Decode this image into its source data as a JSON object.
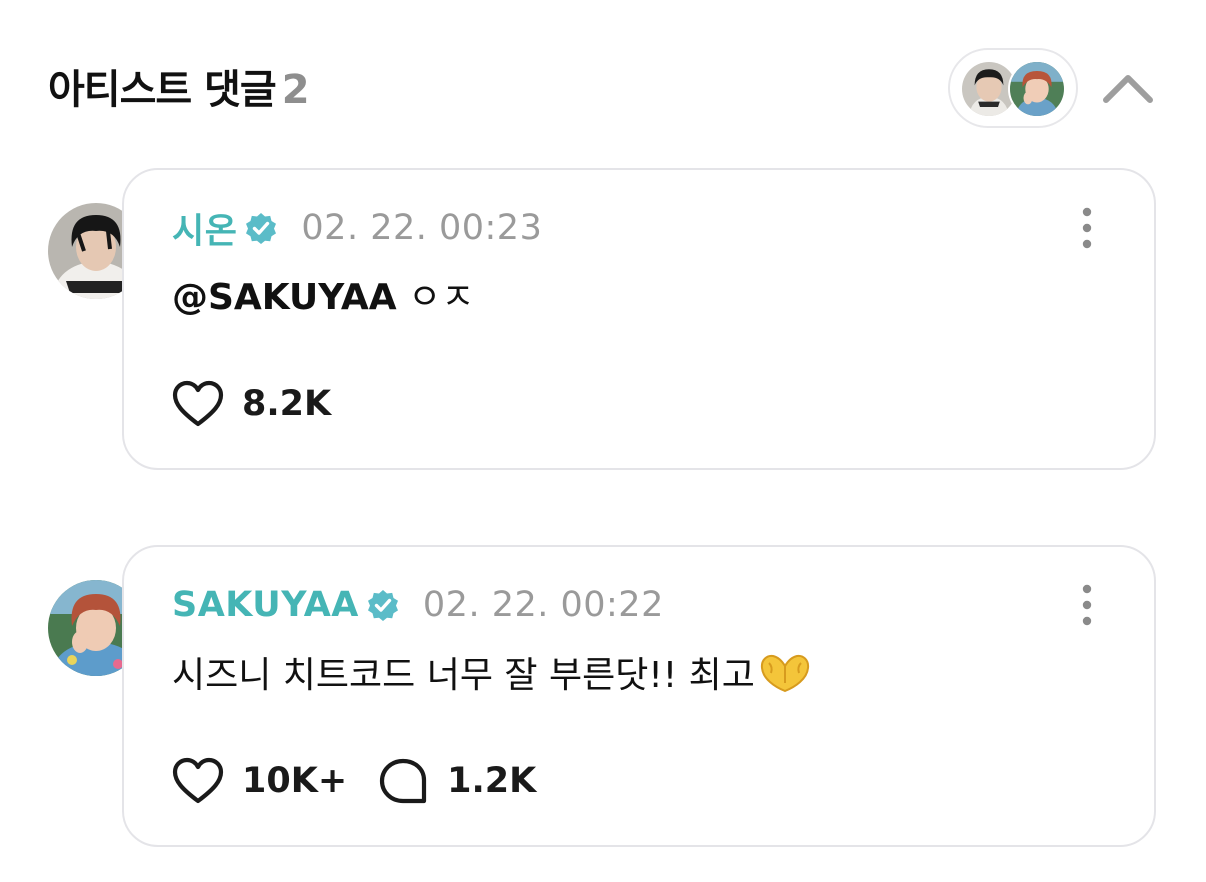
{
  "header": {
    "title": "아티스트 댓글",
    "count": "2"
  },
  "colors": {
    "accent": "#45b5b5",
    "verified_badge": "#5bbcc8",
    "timestamp": "#9a9a9a",
    "card_border": "#e4e4e8"
  },
  "comments": [
    {
      "author": "시온",
      "verified": true,
      "timestamp": "02. 22. 00:23",
      "mention": "@SAKUYAA",
      "text": " ㅇㅈ",
      "likes": "8.2K",
      "replies": null
    },
    {
      "author": "SAKUYAA",
      "verified": true,
      "timestamp": "02. 22. 00:22",
      "text": "시즈니 치트코드 너무 잘 부른닷!! 최고",
      "emoji": "heart-hands-emoji",
      "likes": "10K+",
      "replies": "1.2K"
    }
  ],
  "icons": {
    "collapse": "chevron-up-icon",
    "more": "more-vertical-icon",
    "like": "heart-outline-icon",
    "reply": "speech-bubble-icon",
    "verified": "verified-badge-icon"
  }
}
